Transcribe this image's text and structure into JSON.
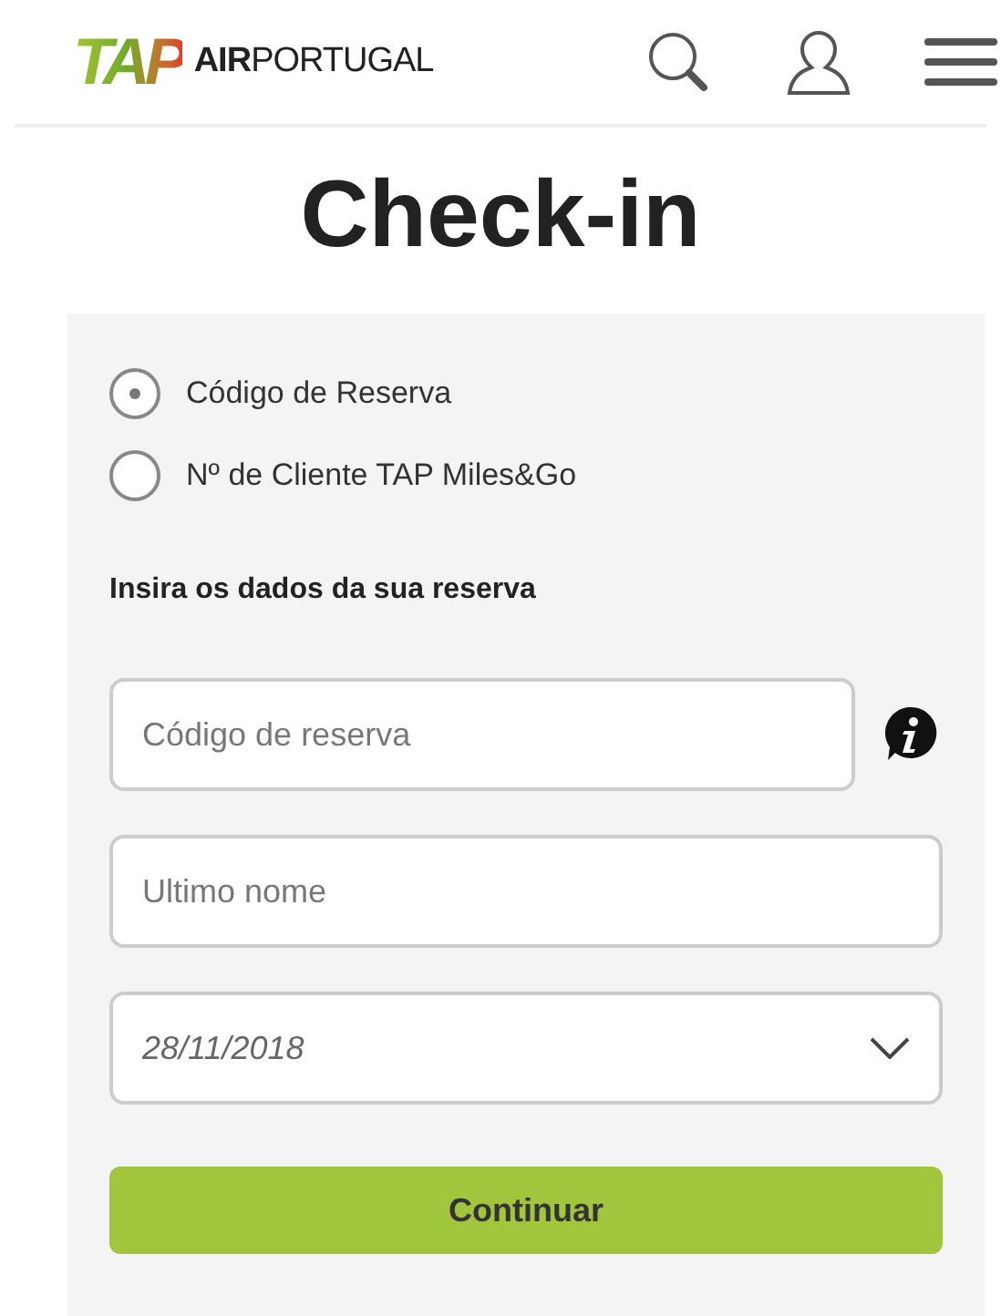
{
  "header": {
    "logo_mark": "TAP",
    "logo_text": "**AIR**PORTUGAL"
  },
  "title": "Check-in",
  "form": {
    "options": [
      {
        "label": "Código de Reserva",
        "selected": true
      },
      {
        "label": "Nº de Cliente TAP Miles&Go",
        "selected": false
      }
    ],
    "instruction": "Insira os dados da sua reserva",
    "fields": [
      {
        "kind": "text",
        "placeholder": "Código de reserva",
        "info": true
      },
      {
        "kind": "text",
        "placeholder": "Ultimo nome",
        "info": false
      },
      {
        "kind": "date",
        "value": "28/11/2018"
      }
    ],
    "submit": "Continuar"
  }
}
